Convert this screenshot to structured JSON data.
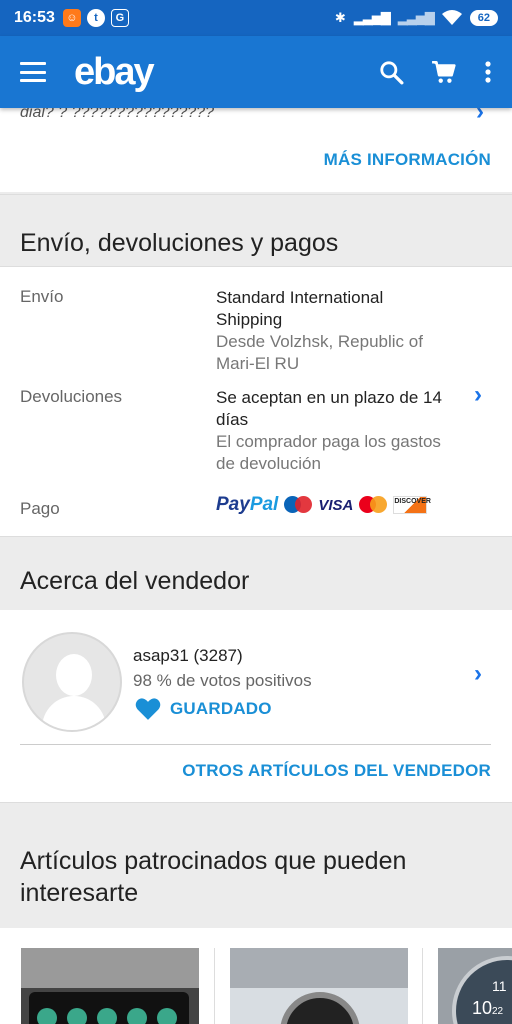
{
  "status_bar": {
    "time": "16:53",
    "battery": "62"
  },
  "app_bar": {
    "logo": "ebay"
  },
  "prev_section": {
    "cut_text": "dial? ? ????????????????",
    "more_info": "MÁS INFORMACIÓN"
  },
  "shipping": {
    "title": "Envío, devoluciones y pagos",
    "envio_label": "Envío",
    "envio_line1": "Standard International",
    "envio_line2": "Shipping",
    "envio_from1": "Desde Volzhsk, Republic of",
    "envio_from2": "Mari-El RU",
    "devol_label": "Devoluciones",
    "devol_line1": "Se aceptan en un plazo de 14",
    "devol_line2": "días",
    "devol_sub1": "El comprador paga los gastos",
    "devol_sub2": "de devolución",
    "pago_label": "Pago",
    "payment_logos": [
      "PayPal",
      "Maestro",
      "VISA",
      "MasterCard",
      "DISCOVER"
    ]
  },
  "seller": {
    "title": "Acerca del vendedor",
    "name": "asap31 (3287)",
    "feedback": "98 % de votos positivos",
    "saved": "GUARDADO",
    "other_items": "OTROS ARTÍCULOS DEL VENDEDOR"
  },
  "sponsored": {
    "title_line1": "Artículos patrocinados que pueden",
    "title_line2": "interesarte",
    "thumb_dial_text_a": "11",
    "thumb_dial_text_b": "10",
    "thumb_dial_text_c": "22"
  },
  "colors": {
    "status_bar": "#1565c0",
    "app_bar": "#1976d2",
    "link": "#1a8fd6",
    "heart": "#1a8fd6"
  }
}
